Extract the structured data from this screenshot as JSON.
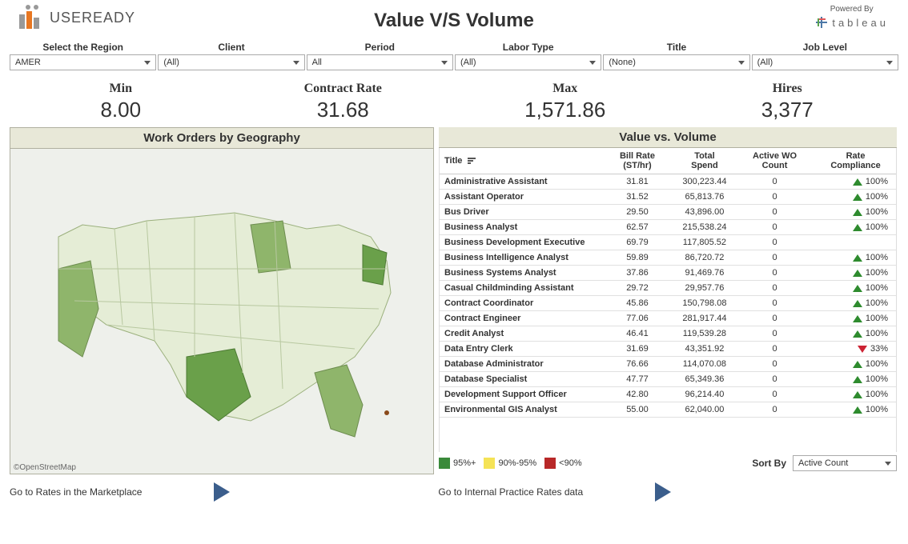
{
  "brand": {
    "name": "USEREADY",
    "powered_by": "Powered By",
    "platform": "tableau"
  },
  "page_title": "Value V/S Volume",
  "filters": [
    {
      "label": "Select the Region",
      "value": "AMER"
    },
    {
      "label": "Client",
      "value": "(All)"
    },
    {
      "label": "Period",
      "value": "All"
    },
    {
      "label": "Labor Type",
      "value": "(All)"
    },
    {
      "label": "Title",
      "value": "(None)"
    },
    {
      "label": "Job Level",
      "value": "(All)"
    }
  ],
  "kpis": {
    "min": {
      "label": "Min",
      "value": "8.00"
    },
    "contract_rate": {
      "label": "Contract Rate",
      "value": "31.68"
    },
    "max": {
      "label": "Max",
      "value": "1,571.86"
    },
    "hires": {
      "label": "Hires",
      "value": "3,377"
    }
  },
  "panels": {
    "map_title": "Work Orders by Geography",
    "map_attribution": "©OpenStreetMap",
    "table_title": "Value vs. Volume"
  },
  "table": {
    "headers": {
      "title": "Title",
      "bill_rate": "Bill Rate (ST/hr)",
      "total_spend": "Total Spend",
      "active_wo": "Active WO Count",
      "rate_compliance": "Rate Compliance"
    },
    "rows": [
      {
        "title": "Administrative Assistant",
        "rate": "31.81",
        "spend": "300,223.44",
        "wo": "0",
        "dir": "up",
        "pct": "100%"
      },
      {
        "title": "Assistant Operator",
        "rate": "31.52",
        "spend": "65,813.76",
        "wo": "0",
        "dir": "up",
        "pct": "100%"
      },
      {
        "title": "Bus Driver",
        "rate": "29.50",
        "spend": "43,896.00",
        "wo": "0",
        "dir": "up",
        "pct": "100%"
      },
      {
        "title": "Business Analyst",
        "rate": "62.57",
        "spend": "215,538.24",
        "wo": "0",
        "dir": "up",
        "pct": "100%"
      },
      {
        "title": "Business Development Executive",
        "rate": "69.79",
        "spend": "117,805.52",
        "wo": "0",
        "dir": "",
        "pct": ""
      },
      {
        "title": "Business Intelligence Analyst",
        "rate": "59.89",
        "spend": "86,720.72",
        "wo": "0",
        "dir": "up",
        "pct": "100%"
      },
      {
        "title": "Business Systems Analyst",
        "rate": "37.86",
        "spend": "91,469.76",
        "wo": "0",
        "dir": "up",
        "pct": "100%"
      },
      {
        "title": "Casual Childminding Assistant",
        "rate": "29.72",
        "spend": "29,957.76",
        "wo": "0",
        "dir": "up",
        "pct": "100%"
      },
      {
        "title": "Contract Coordinator",
        "rate": "45.86",
        "spend": "150,798.08",
        "wo": "0",
        "dir": "up",
        "pct": "100%"
      },
      {
        "title": "Contract Engineer",
        "rate": "77.06",
        "spend": "281,917.44",
        "wo": "0",
        "dir": "up",
        "pct": "100%"
      },
      {
        "title": "Credit Analyst",
        "rate": "46.41",
        "spend": "119,539.28",
        "wo": "0",
        "dir": "up",
        "pct": "100%"
      },
      {
        "title": "Data Entry Clerk",
        "rate": "31.69",
        "spend": "43,351.92",
        "wo": "0",
        "dir": "down",
        "pct": "33%"
      },
      {
        "title": "Database Administrator",
        "rate": "76.66",
        "spend": "114,070.08",
        "wo": "0",
        "dir": "up",
        "pct": "100%"
      },
      {
        "title": "Database Specialist",
        "rate": "47.77",
        "spend": "65,349.36",
        "wo": "0",
        "dir": "up",
        "pct": "100%"
      },
      {
        "title": "Development Support Officer",
        "rate": "42.80",
        "spend": "96,214.40",
        "wo": "0",
        "dir": "up",
        "pct": "100%"
      },
      {
        "title": "Environmental GIS Analyst",
        "rate": "55.00",
        "spend": "62,040.00",
        "wo": "0",
        "dir": "up",
        "pct": "100%"
      }
    ]
  },
  "legend": {
    "green": "95%+",
    "yellow": "90%-95%",
    "red": "<90%"
  },
  "sort_by": {
    "label": "Sort By",
    "value": "Active Count"
  },
  "links": {
    "marketplace": "Go to Rates in the Marketplace",
    "internal": "Go to Internal Practice Rates data"
  },
  "chart_data": {
    "type": "table",
    "title": "Value vs. Volume",
    "columns": [
      "Title",
      "Bill Rate (ST/hr)",
      "Total Spend",
      "Active WO Count",
      "Rate Compliance"
    ],
    "rows": [
      [
        "Administrative Assistant",
        31.81,
        300223.44,
        0,
        100
      ],
      [
        "Assistant Operator",
        31.52,
        65813.76,
        0,
        100
      ],
      [
        "Bus Driver",
        29.5,
        43896.0,
        0,
        100
      ],
      [
        "Business Analyst",
        62.57,
        215538.24,
        0,
        100
      ],
      [
        "Business Development Executive",
        69.79,
        117805.52,
        0,
        null
      ],
      [
        "Business Intelligence Analyst",
        59.89,
        86720.72,
        0,
        100
      ],
      [
        "Business Systems Analyst",
        37.86,
        91469.76,
        0,
        100
      ],
      [
        "Casual Childminding Assistant",
        29.72,
        29957.76,
        0,
        100
      ],
      [
        "Contract Coordinator",
        45.86,
        150798.08,
        0,
        100
      ],
      [
        "Contract Engineer",
        77.06,
        281917.44,
        0,
        100
      ],
      [
        "Credit Analyst",
        46.41,
        119539.28,
        0,
        100
      ],
      [
        "Data Entry Clerk",
        31.69,
        43351.92,
        0,
        33
      ],
      [
        "Database Administrator",
        76.66,
        114070.08,
        0,
        100
      ],
      [
        "Database Specialist",
        47.77,
        65349.36,
        0,
        100
      ],
      [
        "Development Support Officer",
        42.8,
        96214.4,
        0,
        100
      ],
      [
        "Environmental GIS Analyst",
        55.0,
        62040.0,
        0,
        100
      ]
    ]
  }
}
